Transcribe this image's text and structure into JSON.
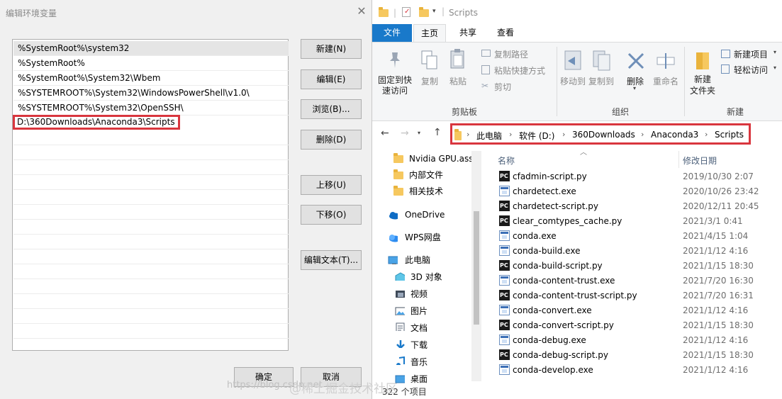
{
  "dialog": {
    "title": "编辑环境变量",
    "close_glyph": "✕",
    "paths": [
      "%SystemRoot%\\system32",
      "%SystemRoot%",
      "%SystemRoot%\\System32\\Wbem",
      "%SYSTEMROOT%\\System32\\WindowsPowerShell\\v1.0\\",
      "%SYSTEMROOT%\\System32\\OpenSSH\\",
      "D:\\360Downloads\\Anaconda3\\Scripts"
    ],
    "buttons": {
      "new": "新建(N)",
      "edit": "编辑(E)",
      "browse": "浏览(B)...",
      "delete": "删除(D)",
      "move_up": "上移(U)",
      "move_down": "下移(O)",
      "edit_text": "编辑文本(T)...",
      "ok": "确定",
      "cancel": "取消"
    }
  },
  "explorer": {
    "window_title": "Scripts",
    "tabs": {
      "file": "文件",
      "home": "主页",
      "share": "共享",
      "view": "查看"
    },
    "ribbon": {
      "pin": "固定到快\n速访问",
      "copy": "复制",
      "paste": "粘贴",
      "copy_path": "复制路径",
      "paste_shortcut": "粘贴快捷方式",
      "cut": "剪切",
      "group_clipboard": "剪贴板",
      "move_to": "移动到",
      "copy_to": "复制到",
      "delete": "删除",
      "rename": "重命名",
      "group_organize": "组织",
      "new_folder": "新建\n文件夹",
      "new_item": "新建项目",
      "easy_access": "轻松访问",
      "group_new": "新建"
    },
    "address": [
      "此电脑",
      "软件 (D:)",
      "360Downloads",
      "Anaconda3",
      "Scripts"
    ],
    "nav": [
      {
        "label": "Nvidia GPU.ass",
        "icon": "folder-icon"
      },
      {
        "label": "内部文件",
        "icon": "folder-icon"
      },
      {
        "label": "相关技术",
        "icon": "folder-icon"
      },
      {
        "label": "OneDrive",
        "icon": "cloud-icon"
      },
      {
        "label": "WPS网盘",
        "icon": "wps-cloud-icon"
      },
      {
        "label": "此电脑",
        "icon": "computer-icon"
      },
      {
        "label": "3D 对象",
        "icon": "3d-objects-icon"
      },
      {
        "label": "视频",
        "icon": "video-icon"
      },
      {
        "label": "图片",
        "icon": "picture-icon"
      },
      {
        "label": "文档",
        "icon": "document-icon"
      },
      {
        "label": "下载",
        "icon": "download-icon"
      },
      {
        "label": "音乐",
        "icon": "music-icon"
      },
      {
        "label": "桌面",
        "icon": "desktop-icon"
      }
    ],
    "columns": {
      "name": "名称",
      "date": "修改日期"
    },
    "files": [
      {
        "name": "cfadmin-script.py",
        "date": "2019/10/30 2:07",
        "type": "py"
      },
      {
        "name": "chardetect.exe",
        "date": "2020/10/26 23:42",
        "type": "exe"
      },
      {
        "name": "chardetect-script.py",
        "date": "2020/12/11 20:45",
        "type": "py"
      },
      {
        "name": "clear_comtypes_cache.py",
        "date": "2021/3/1 0:41",
        "type": "py"
      },
      {
        "name": "conda.exe",
        "date": "2021/4/15 1:04",
        "type": "exe"
      },
      {
        "name": "conda-build.exe",
        "date": "2021/1/12 4:16",
        "type": "exe"
      },
      {
        "name": "conda-build-script.py",
        "date": "2021/1/15 18:30",
        "type": "py"
      },
      {
        "name": "conda-content-trust.exe",
        "date": "2021/7/20 16:30",
        "type": "exe"
      },
      {
        "name": "conda-content-trust-script.py",
        "date": "2021/7/20 16:31",
        "type": "py"
      },
      {
        "name": "conda-convert.exe",
        "date": "2021/1/12 4:16",
        "type": "exe"
      },
      {
        "name": "conda-convert-script.py",
        "date": "2021/1/15 18:30",
        "type": "py"
      },
      {
        "name": "conda-debug.exe",
        "date": "2021/1/12 4:16",
        "type": "exe"
      },
      {
        "name": "conda-debug-script.py",
        "date": "2021/1/15 18:30",
        "type": "py"
      },
      {
        "name": "conda-develop.exe",
        "date": "2021/1/12 4:16",
        "type": "exe"
      }
    ],
    "status": "322 个项目"
  },
  "watermark": {
    "small": "https://blog.csdn.net",
    "large": "@稀土掘金技术社区"
  },
  "colors": {
    "accent": "#1979ca",
    "highlight": "#d9363e",
    "folder": "#f6c85f"
  }
}
